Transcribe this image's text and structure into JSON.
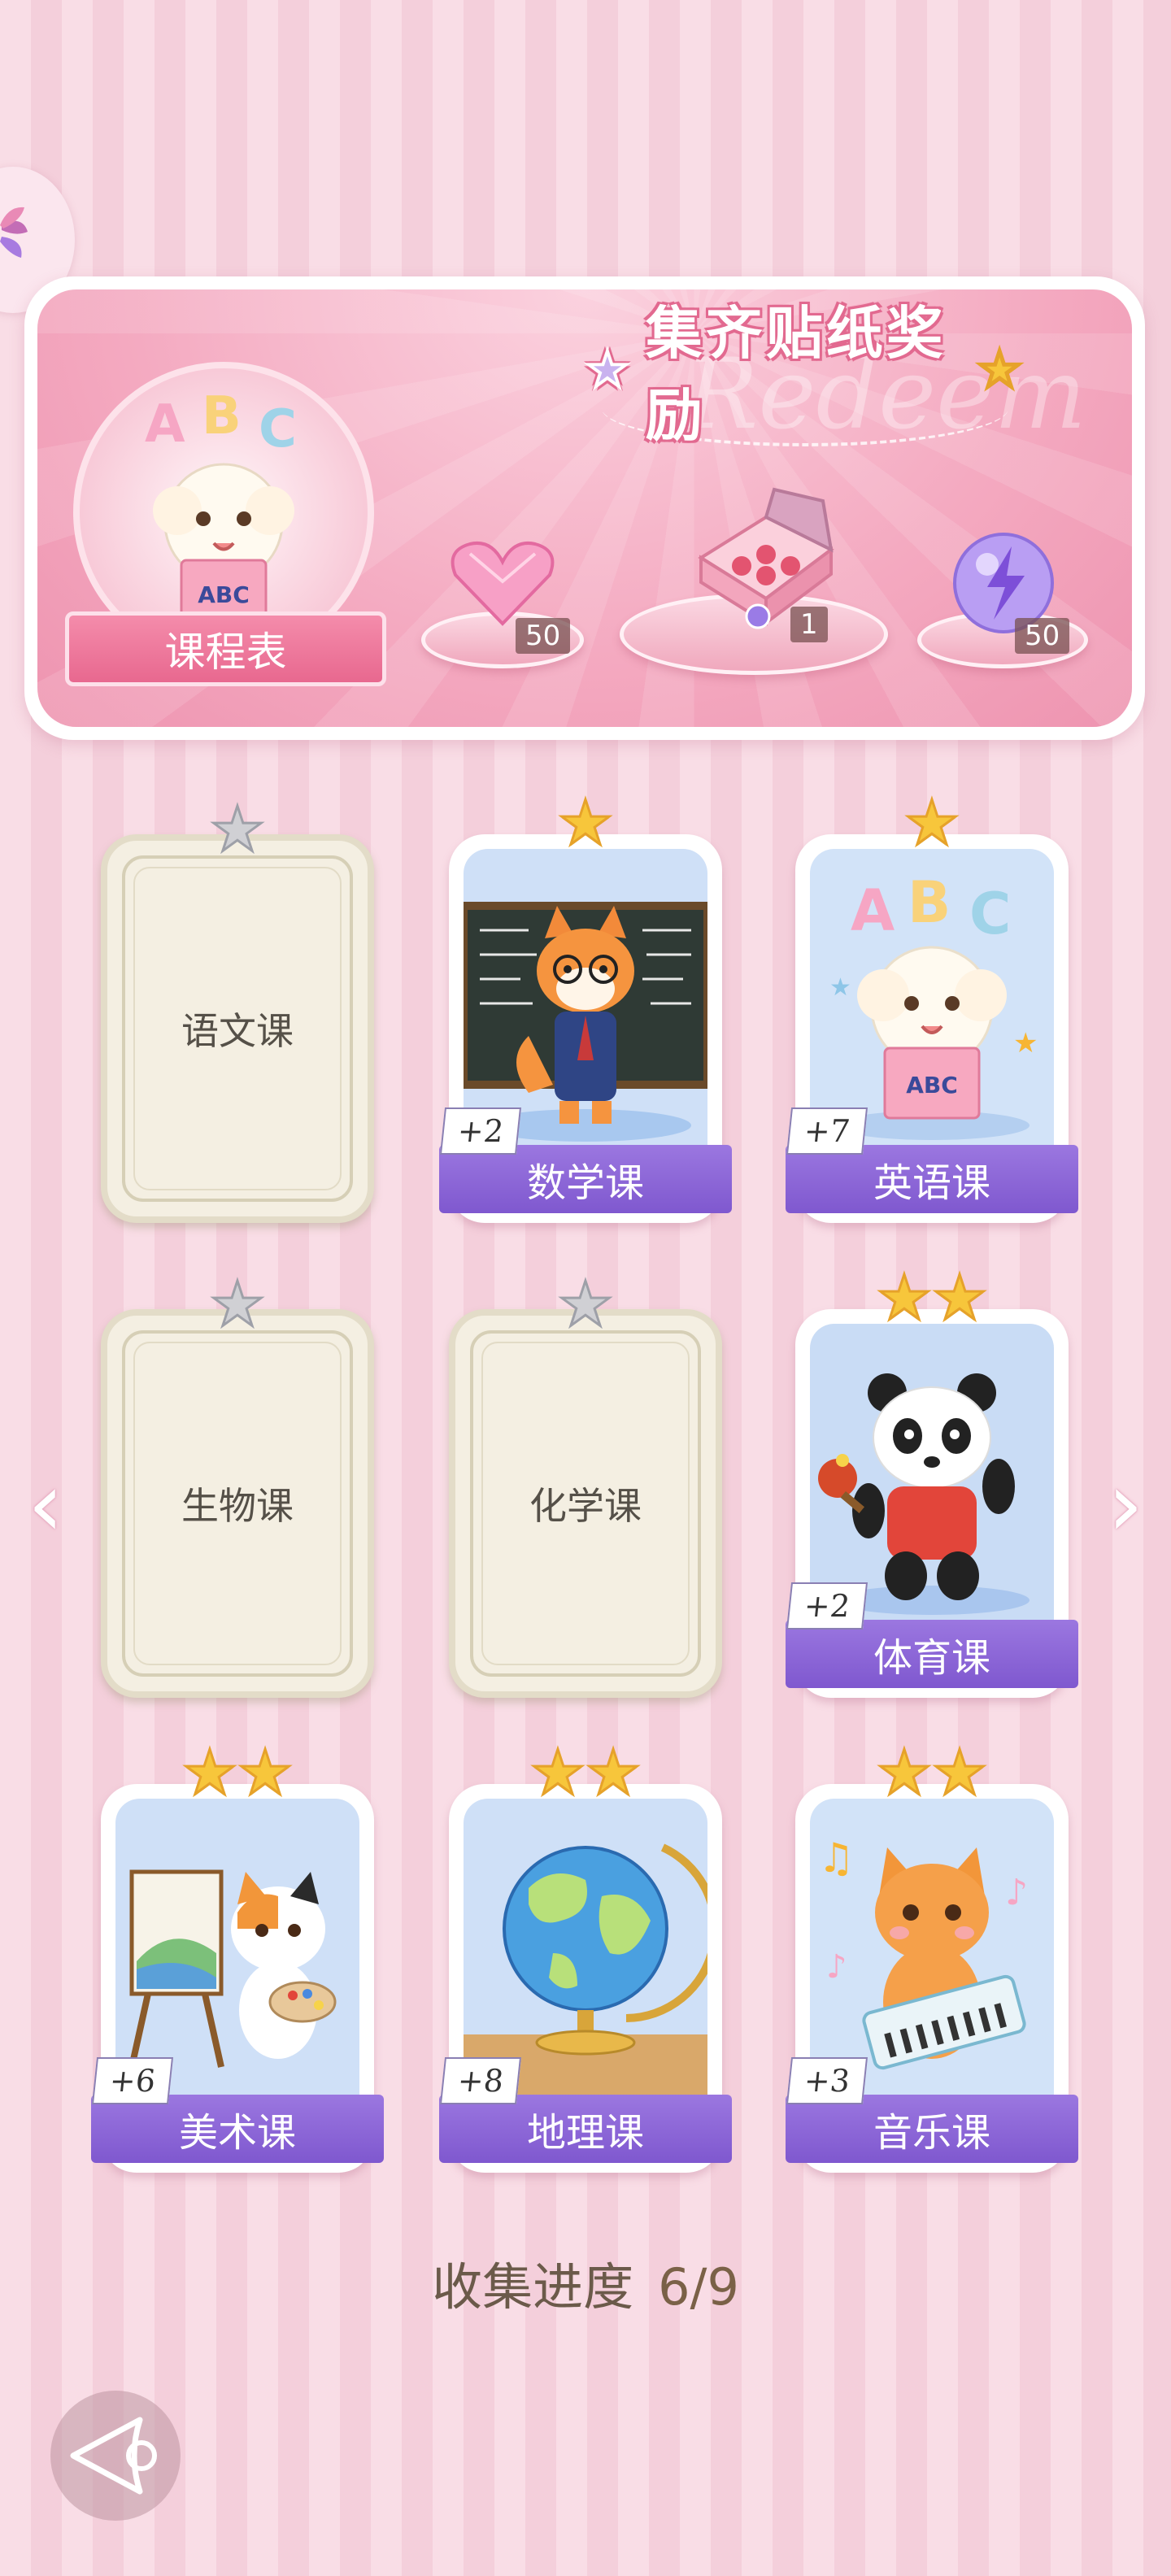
{
  "banner": {
    "title": "集齐贴纸奖励",
    "watermark": "Redeem",
    "schedule_label": "课程表",
    "rewards": [
      {
        "name": "heart-gem",
        "count": "50"
      },
      {
        "name": "gift-box",
        "count": "1"
      },
      {
        "name": "lightning-orb",
        "count": "50"
      }
    ]
  },
  "courses": [
    {
      "name": "语文课",
      "stars": 1,
      "unlocked": false,
      "bonus": ""
    },
    {
      "name": "数学课",
      "stars": 1,
      "unlocked": true,
      "bonus": "+2"
    },
    {
      "name": "英语课",
      "stars": 1,
      "unlocked": true,
      "bonus": "+7"
    },
    {
      "name": "生物课",
      "stars": 1,
      "unlocked": false,
      "bonus": ""
    },
    {
      "name": "化学课",
      "stars": 1,
      "unlocked": false,
      "bonus": ""
    },
    {
      "name": "体育课",
      "stars": 2,
      "unlocked": true,
      "bonus": "+2"
    },
    {
      "name": "美术课",
      "stars": 2,
      "unlocked": true,
      "bonus": "+6"
    },
    {
      "name": "地理课",
      "stars": 2,
      "unlocked": true,
      "bonus": "+8"
    },
    {
      "name": "音乐课",
      "stars": 2,
      "unlocked": true,
      "bonus": "+3"
    }
  ],
  "progress": {
    "label": "收集进度",
    "value": "6/9"
  },
  "colors": {
    "gold_star": "#f7c63b",
    "gray_star": "#d0d0d4",
    "ribbon": "#8a63d6",
    "accent_pink": "#ee94b0"
  }
}
